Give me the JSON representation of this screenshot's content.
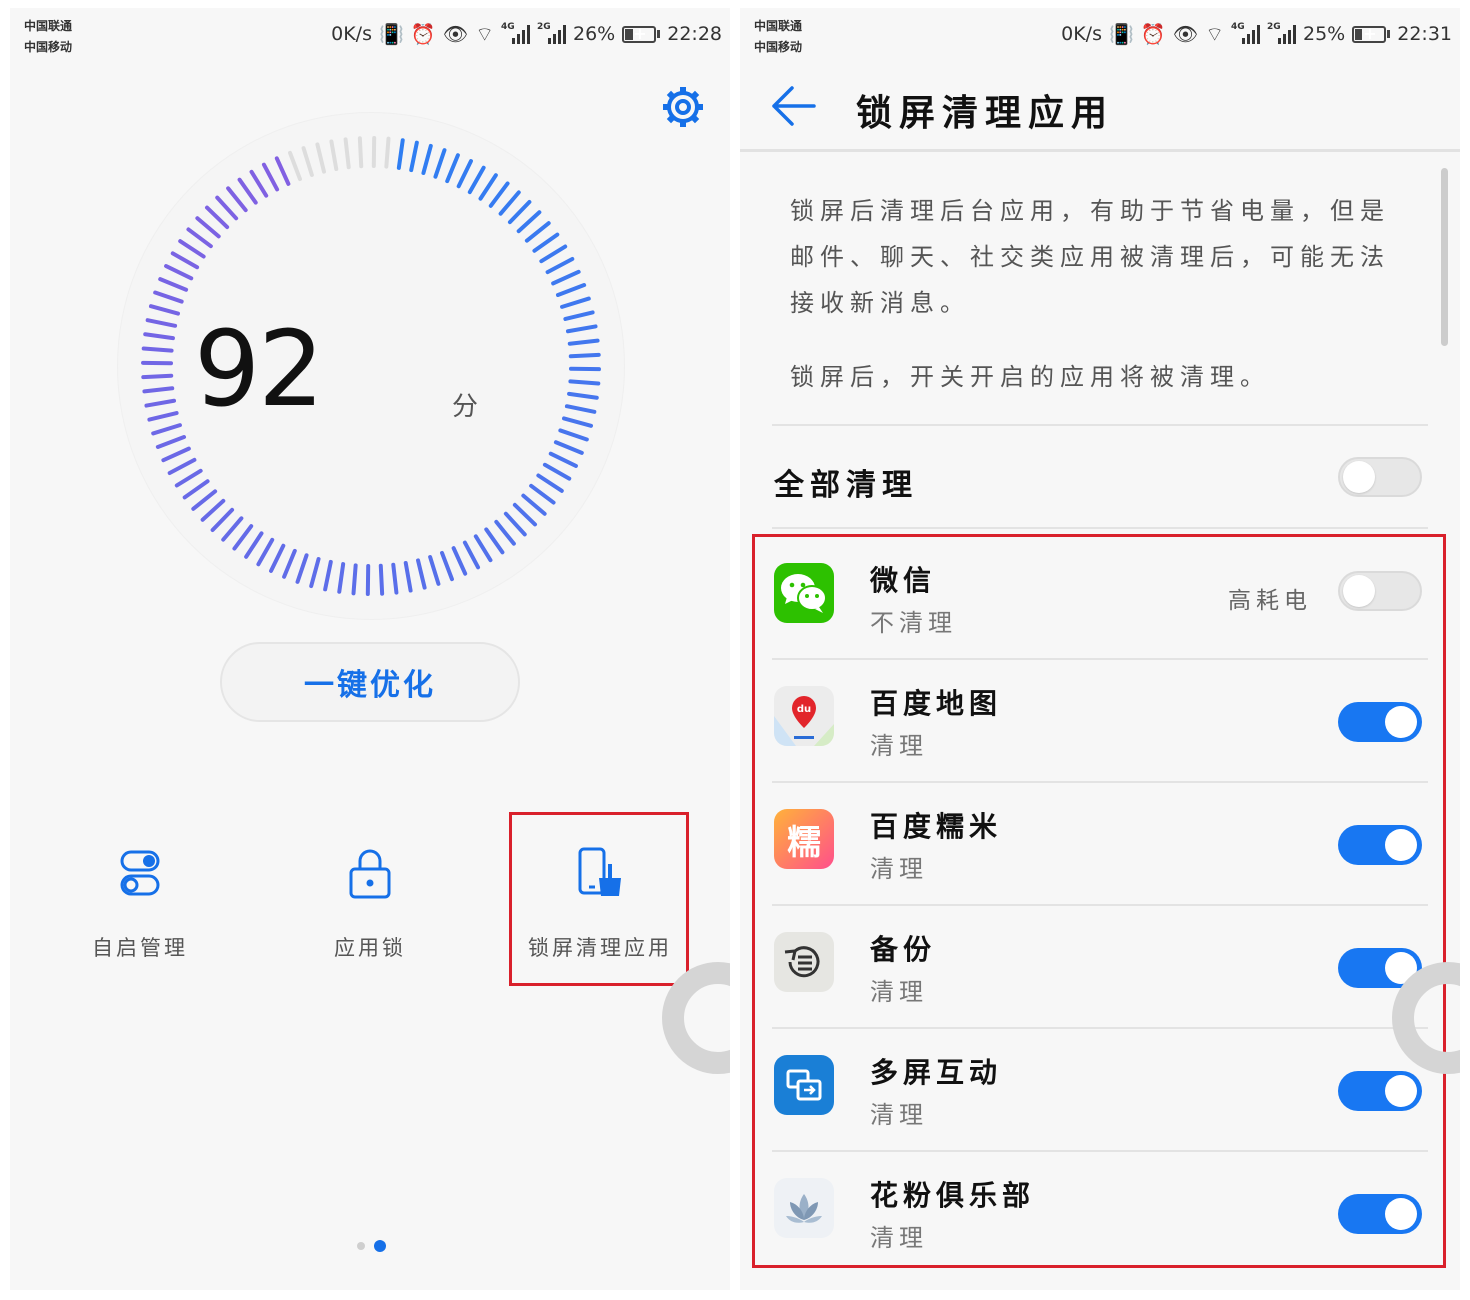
{
  "left": {
    "status": {
      "carrier1": "中国联通",
      "carrier2": "中国移动",
      "speed": "0K/s",
      "network1": "4G",
      "network2": "2G",
      "battery": "26%",
      "battery_level": 0.26,
      "time": "22:28"
    },
    "score": {
      "value": "92",
      "unit": "分",
      "gauge_fraction": 0.92
    },
    "optimize_label": "一键优化",
    "tools": [
      {
        "label": "自启管理",
        "icon": "toggles-icon"
      },
      {
        "label": "应用锁",
        "icon": "padlock-icon"
      },
      {
        "label": "锁屏清理应用",
        "icon": "phone-broom-icon"
      }
    ],
    "pager": {
      "count": 2,
      "active": 1
    }
  },
  "right": {
    "status": {
      "carrier1": "中国联通",
      "carrier2": "中国移动",
      "speed": "0K/s",
      "network1": "4G",
      "network2": "2G",
      "battery": "25%",
      "battery_level": 0.25,
      "time": "22:31"
    },
    "title": "锁屏清理应用",
    "description": "锁屏后清理后台应用，有助于节省电量，但是邮件、聊天、社交类应用被清理后，可能无法接收新消息。",
    "description2": "锁屏后，开关开启的应用将被清理。",
    "all_clean_label": "全部清理",
    "all_clean_on": false,
    "apps": [
      {
        "name": "微信",
        "status": "不清理",
        "tag": "高耗电",
        "on": false,
        "icon": "wechat-icon",
        "color": "#2dc100"
      },
      {
        "name": "百度地图",
        "status": "清理",
        "tag": "",
        "on": true,
        "icon": "baidu-map-icon",
        "color": "#e8e8e8"
      },
      {
        "name": "百度糯米",
        "status": "清理",
        "tag": "",
        "on": true,
        "icon": "baidu-nuomi-icon",
        "color": "#ff4f8b",
        "glyph": "糯"
      },
      {
        "name": "备份",
        "status": "清理",
        "tag": "",
        "on": true,
        "icon": "backup-icon",
        "color": "#e3e3e0"
      },
      {
        "name": "多屏互动",
        "status": "清理",
        "tag": "",
        "on": true,
        "icon": "multiscreen-icon",
        "color": "#1a7fd6"
      },
      {
        "name": "花粉俱乐部",
        "status": "清理",
        "tag": "",
        "on": true,
        "icon": "huafen-club-icon",
        "color": "#eef1f5"
      }
    ]
  },
  "accent": "#1877f2",
  "highlight_color": "#d9202b"
}
